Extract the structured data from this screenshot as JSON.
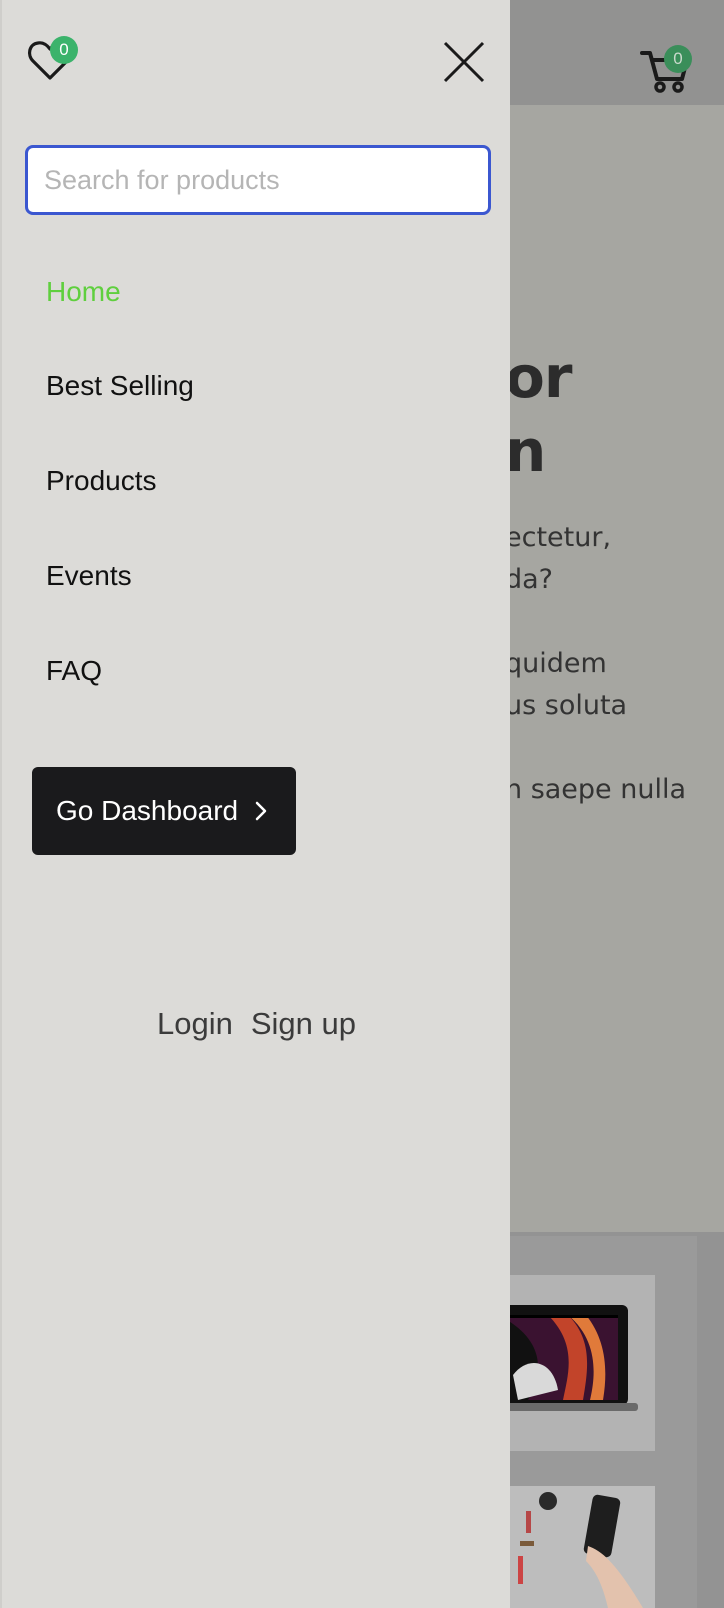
{
  "drawer": {
    "wishlist_count": "0",
    "search": {
      "placeholder": "Search for products",
      "value": ""
    },
    "nav": [
      {
        "label": "Home",
        "active": true
      },
      {
        "label": "Best Selling",
        "active": false
      },
      {
        "label": "Products",
        "active": false
      },
      {
        "label": "Events",
        "active": false
      },
      {
        "label": "FAQ",
        "active": false
      }
    ],
    "dashboard_button": "Go Dashboard",
    "login": "Login",
    "signup": "Sign up"
  },
  "background": {
    "cart_count": "0",
    "hero_title_fragments": [
      "or",
      "n"
    ],
    "hero_text_fragments": [
      "ectetur,",
      "da?",
      "quidem",
      "us soluta",
      "n saepe nulla"
    ]
  },
  "colors": {
    "accent_active": "#5fcf3e",
    "search_border": "#3b57d0",
    "badge": "#3bb36b",
    "button_bg": "#1a1a1c"
  },
  "icons": [
    "heart-icon",
    "close-icon",
    "chevron-right-icon",
    "cart-icon"
  ]
}
